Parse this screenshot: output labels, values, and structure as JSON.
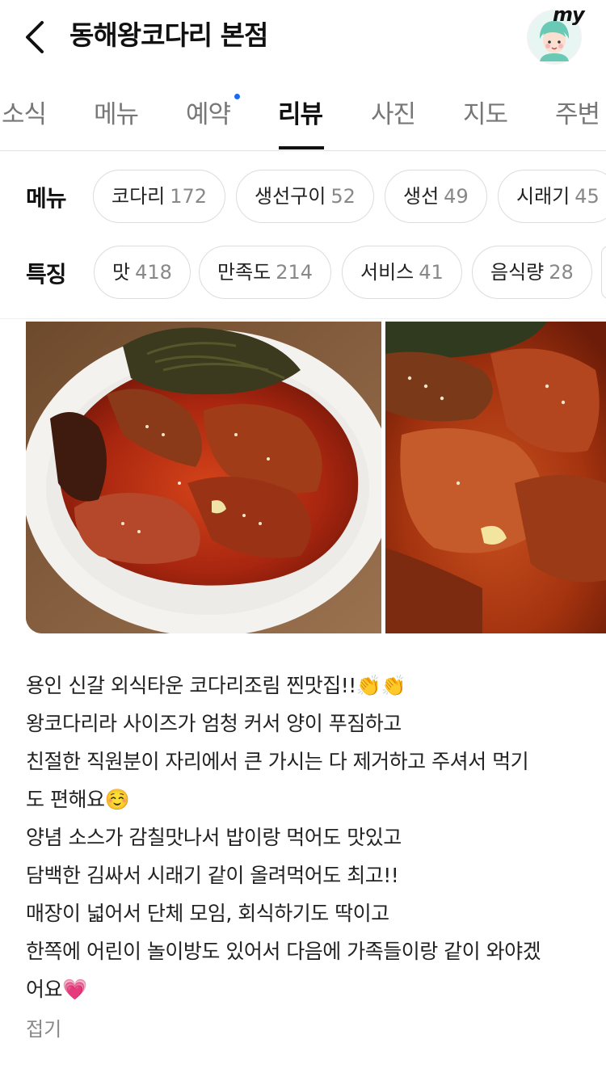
{
  "header": {
    "title": "동해왕코다리 본점",
    "my_label": "my"
  },
  "tabs": [
    {
      "label": "소식"
    },
    {
      "label": "메뉴"
    },
    {
      "label": "예약"
    },
    {
      "label": "리뷰"
    },
    {
      "label": "사진"
    },
    {
      "label": "지도"
    },
    {
      "label": "주변"
    }
  ],
  "filters": {
    "menu": {
      "label": "메뉴",
      "chips": [
        {
          "name": "코다리",
          "count": "172"
        },
        {
          "name": "생선구이",
          "count": "52"
        },
        {
          "name": "생선",
          "count": "49"
        },
        {
          "name": "시래기",
          "count": "45"
        }
      ]
    },
    "feature": {
      "label": "특징",
      "chips": [
        {
          "name": "맛",
          "count": "418"
        },
        {
          "name": "만족도",
          "count": "214"
        },
        {
          "name": "서비스",
          "count": "41"
        },
        {
          "name": "음식량",
          "count": "28"
        }
      ]
    }
  },
  "review": {
    "lines": [
      "용인 신갈 외식타운 코다리조림 찐맛집!!👏👏",
      "왕코다리라 사이즈가 엄청 커서 양이 푸짐하고",
      "친절한 직원분이 자리에서 큰 가시는 다 제거하고 주셔서 먹기",
      "도 편해요☺️",
      "양념 소스가 감칠맛나서 밥이랑 먹어도 맛있고",
      "담백한 김싸서 시래기 같이 올려먹어도 최고!!",
      "매장이 넓어서 단체 모임, 회식하기도 딱이고",
      "한쪽에 어린이 놀이방도 있어서 다음에 가족들이랑 같이 와야겠",
      "어요💗"
    ],
    "fold_label": "접기"
  },
  "colors": {
    "accent_dot": "#1b6af0",
    "chip_border": "#dcdcdc",
    "muted_text": "#888888"
  }
}
